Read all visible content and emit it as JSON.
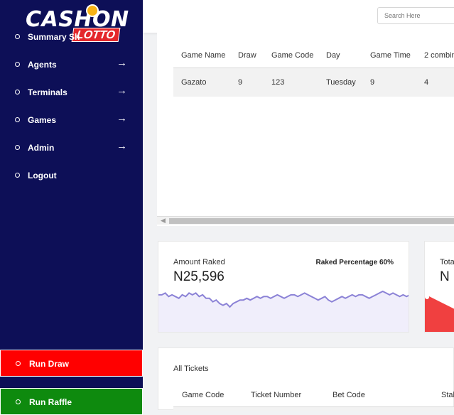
{
  "brand": {
    "name_top": "CASHON",
    "name_bottom": "LOTTO"
  },
  "sidebar": {
    "items": [
      {
        "label": "Summary Sh",
        "has_arrow": false
      },
      {
        "label": "Agents",
        "has_arrow": true
      },
      {
        "label": "Terminals",
        "has_arrow": true
      },
      {
        "label": "Games",
        "has_arrow": true
      },
      {
        "label": "Admin",
        "has_arrow": true
      },
      {
        "label": "Logout",
        "has_arrow": false
      }
    ],
    "arrow_glyph": "→",
    "run_draw": "Run Draw",
    "run_raffle": "Run Raffle"
  },
  "search": {
    "placeholder": "Search Here"
  },
  "games_table": {
    "headers": [
      "Game Name",
      "Draw",
      "Game Code",
      "Day",
      "Game Time",
      "2 combin"
    ],
    "rows": [
      [
        "Gazato",
        "9",
        "123",
        "Tuesday",
        "9",
        "4"
      ]
    ]
  },
  "amount_raked": {
    "title": "Amount Raked",
    "value": "N25,596",
    "raked_percentage": "Raked Percentage 60%",
    "sparkline": [
      7,
      7,
      8,
      6,
      7,
      6,
      5,
      7,
      6,
      8,
      7,
      8,
      6,
      7,
      5,
      5,
      3,
      4,
      2,
      1,
      2,
      0,
      2,
      3,
      4,
      4,
      5,
      4,
      5,
      6,
      5,
      6,
      6,
      5,
      6,
      7,
      6,
      5,
      6,
      7,
      7,
      6,
      7,
      8,
      7,
      6,
      5,
      4,
      5,
      6,
      4,
      3,
      4,
      5,
      6,
      5,
      6,
      7,
      6,
      7,
      7,
      6,
      5,
      6,
      7,
      8,
      9,
      8,
      7,
      8,
      7,
      6,
      7,
      6,
      7
    ]
  },
  "total_card": {
    "title": "Tota",
    "value": "N"
  },
  "tickets": {
    "title": "All Tickets",
    "headers": [
      "Game Code",
      "Ticket Number",
      "Bet Code",
      "Stak"
    ]
  },
  "colors": {
    "sidebar_bg": "#0d0f57",
    "run_draw": "#ff0000",
    "run_raffle": "#0e8a0e",
    "sparkline_stroke": "#8b82d6",
    "sparkline_fill": "#f0eefb",
    "total_area": "#f04040"
  }
}
